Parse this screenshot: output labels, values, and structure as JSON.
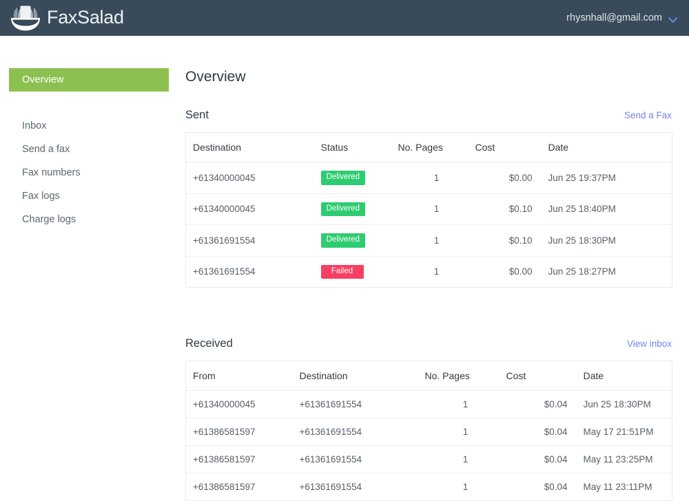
{
  "header": {
    "brand_name": "FaxSalad",
    "brand_logo_icon": "salad-bowl-icon",
    "account_email": "rhysnhall@gmail.com",
    "account_chevron_icon": "chevron-down-icon",
    "background_color": "#394b5a",
    "accent_color": "#8cc152"
  },
  "sidebar": {
    "items": [
      {
        "label": "Overview",
        "active": true
      },
      {
        "label": "Inbox",
        "active": false
      },
      {
        "label": "Send a fax",
        "active": false
      },
      {
        "label": "Fax numbers",
        "active": false
      },
      {
        "label": "Fax logs",
        "active": false
      },
      {
        "label": "Charge logs",
        "active": false
      }
    ]
  },
  "main": {
    "page_title": "Overview",
    "sent": {
      "title": "Sent",
      "link_label": "Send a Fax",
      "columns": [
        "Destination",
        "Status",
        "No. Pages",
        "Cost",
        "Date"
      ],
      "rows": [
        {
          "destination": "+61340000045",
          "status": "Delivered",
          "status_type": "delivered",
          "pages": "1",
          "cost": "$0.00",
          "date": "Jun 25 19:37PM"
        },
        {
          "destination": "+61340000045",
          "status": "Delivered",
          "status_type": "delivered",
          "pages": "1",
          "cost": "$0.10",
          "date": "Jun 25 18:40PM"
        },
        {
          "destination": "+61361691554",
          "status": "Delivered",
          "status_type": "delivered",
          "pages": "1",
          "cost": "$0.10",
          "date": "Jun 25 18:30PM"
        },
        {
          "destination": "+61361691554",
          "status": "Failed",
          "status_type": "failed",
          "pages": "1",
          "cost": "$0.00",
          "date": "Jun 25 18:27PM"
        }
      ]
    },
    "received": {
      "title": "Received",
      "link_label": "View inbox",
      "columns": [
        "From",
        "Destination",
        "No. Pages",
        "Cost",
        "Date"
      ],
      "rows": [
        {
          "from": "+61340000045",
          "destination": "+61361691554",
          "pages": "1",
          "cost": "$0.04",
          "date": "Jun 25 18:30PM"
        },
        {
          "from": "+61386581597",
          "destination": "+61361691554",
          "pages": "1",
          "cost": "$0.04",
          "date": "May 17 21:51PM"
        },
        {
          "from": "+61386581597",
          "destination": "+61361691554",
          "pages": "1",
          "cost": "$0.04",
          "date": "May 11 23:25PM"
        },
        {
          "from": "+61386581597",
          "destination": "+61361691554",
          "pages": "1",
          "cost": "$0.04",
          "date": "May 11 23:11PM"
        }
      ]
    }
  },
  "colors": {
    "badge_delivered": "#2ecc71",
    "badge_failed": "#f73f63",
    "link": "#7684e8",
    "sidebar_active": "#8cc152"
  }
}
